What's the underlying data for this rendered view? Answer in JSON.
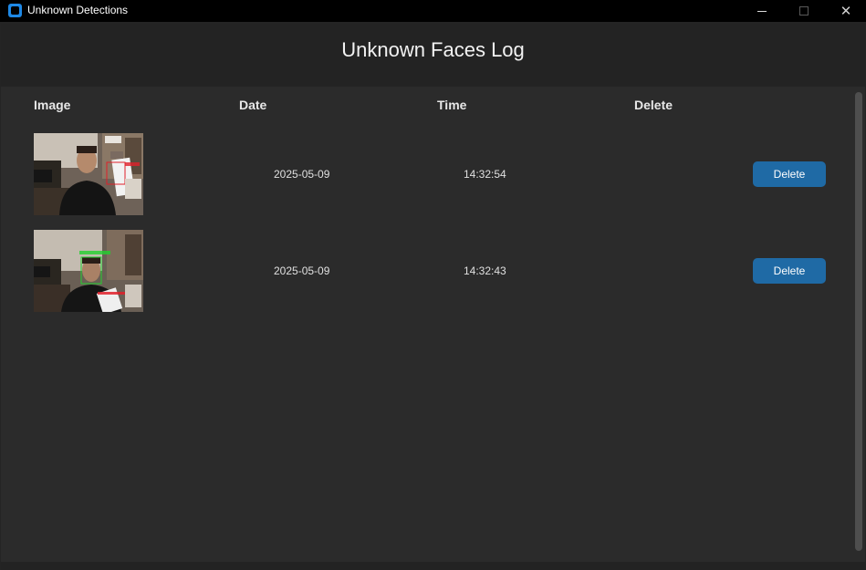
{
  "window": {
    "title": "Unknown Detections",
    "controls": {
      "minimize_icon": "minimize-icon",
      "maximize_icon": "maximize-icon",
      "close_icon": "close-icon",
      "close_glyph": "✕"
    }
  },
  "header": {
    "title": "Unknown Faces Log"
  },
  "table": {
    "columns": [
      "Image",
      "Date",
      "Time",
      "Delete"
    ],
    "rows": [
      {
        "date": "2025-05-09",
        "time": "14:32:54",
        "delete_label": "Delete"
      },
      {
        "date": "2025-05-09",
        "time": "14:32:43",
        "delete_label": "Delete"
      }
    ]
  },
  "colors": {
    "accent": "#1f6aa5",
    "background": "#242424",
    "panel": "#2b2b2b",
    "titlebar": "#000000"
  }
}
